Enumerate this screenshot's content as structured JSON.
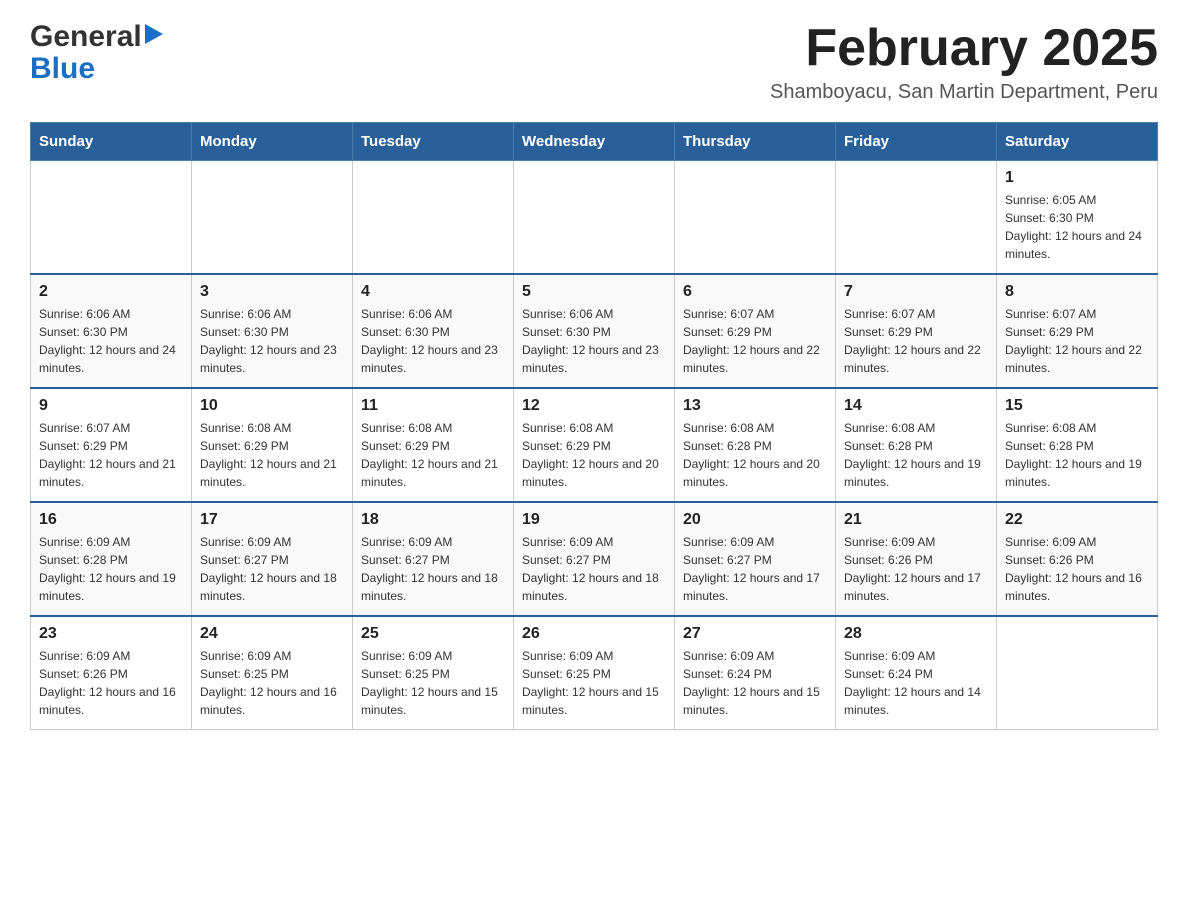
{
  "header": {
    "logo_general": "General",
    "logo_blue": "Blue",
    "title": "February 2025",
    "subtitle": "Shamboyacu, San Martin Department, Peru"
  },
  "weekdays": [
    "Sunday",
    "Monday",
    "Tuesday",
    "Wednesday",
    "Thursday",
    "Friday",
    "Saturday"
  ],
  "weeks": [
    [
      {
        "day": "",
        "info": ""
      },
      {
        "day": "",
        "info": ""
      },
      {
        "day": "",
        "info": ""
      },
      {
        "day": "",
        "info": ""
      },
      {
        "day": "",
        "info": ""
      },
      {
        "day": "",
        "info": ""
      },
      {
        "day": "1",
        "info": "Sunrise: 6:05 AM\nSunset: 6:30 PM\nDaylight: 12 hours and 24 minutes."
      }
    ],
    [
      {
        "day": "2",
        "info": "Sunrise: 6:06 AM\nSunset: 6:30 PM\nDaylight: 12 hours and 24 minutes."
      },
      {
        "day": "3",
        "info": "Sunrise: 6:06 AM\nSunset: 6:30 PM\nDaylight: 12 hours and 23 minutes."
      },
      {
        "day": "4",
        "info": "Sunrise: 6:06 AM\nSunset: 6:30 PM\nDaylight: 12 hours and 23 minutes."
      },
      {
        "day": "5",
        "info": "Sunrise: 6:06 AM\nSunset: 6:30 PM\nDaylight: 12 hours and 23 minutes."
      },
      {
        "day": "6",
        "info": "Sunrise: 6:07 AM\nSunset: 6:29 PM\nDaylight: 12 hours and 22 minutes."
      },
      {
        "day": "7",
        "info": "Sunrise: 6:07 AM\nSunset: 6:29 PM\nDaylight: 12 hours and 22 minutes."
      },
      {
        "day": "8",
        "info": "Sunrise: 6:07 AM\nSunset: 6:29 PM\nDaylight: 12 hours and 22 minutes."
      }
    ],
    [
      {
        "day": "9",
        "info": "Sunrise: 6:07 AM\nSunset: 6:29 PM\nDaylight: 12 hours and 21 minutes."
      },
      {
        "day": "10",
        "info": "Sunrise: 6:08 AM\nSunset: 6:29 PM\nDaylight: 12 hours and 21 minutes."
      },
      {
        "day": "11",
        "info": "Sunrise: 6:08 AM\nSunset: 6:29 PM\nDaylight: 12 hours and 21 minutes."
      },
      {
        "day": "12",
        "info": "Sunrise: 6:08 AM\nSunset: 6:29 PM\nDaylight: 12 hours and 20 minutes."
      },
      {
        "day": "13",
        "info": "Sunrise: 6:08 AM\nSunset: 6:28 PM\nDaylight: 12 hours and 20 minutes."
      },
      {
        "day": "14",
        "info": "Sunrise: 6:08 AM\nSunset: 6:28 PM\nDaylight: 12 hours and 19 minutes."
      },
      {
        "day": "15",
        "info": "Sunrise: 6:08 AM\nSunset: 6:28 PM\nDaylight: 12 hours and 19 minutes."
      }
    ],
    [
      {
        "day": "16",
        "info": "Sunrise: 6:09 AM\nSunset: 6:28 PM\nDaylight: 12 hours and 19 minutes."
      },
      {
        "day": "17",
        "info": "Sunrise: 6:09 AM\nSunset: 6:27 PM\nDaylight: 12 hours and 18 minutes."
      },
      {
        "day": "18",
        "info": "Sunrise: 6:09 AM\nSunset: 6:27 PM\nDaylight: 12 hours and 18 minutes."
      },
      {
        "day": "19",
        "info": "Sunrise: 6:09 AM\nSunset: 6:27 PM\nDaylight: 12 hours and 18 minutes."
      },
      {
        "day": "20",
        "info": "Sunrise: 6:09 AM\nSunset: 6:27 PM\nDaylight: 12 hours and 17 minutes."
      },
      {
        "day": "21",
        "info": "Sunrise: 6:09 AM\nSunset: 6:26 PM\nDaylight: 12 hours and 17 minutes."
      },
      {
        "day": "22",
        "info": "Sunrise: 6:09 AM\nSunset: 6:26 PM\nDaylight: 12 hours and 16 minutes."
      }
    ],
    [
      {
        "day": "23",
        "info": "Sunrise: 6:09 AM\nSunset: 6:26 PM\nDaylight: 12 hours and 16 minutes."
      },
      {
        "day": "24",
        "info": "Sunrise: 6:09 AM\nSunset: 6:25 PM\nDaylight: 12 hours and 16 minutes."
      },
      {
        "day": "25",
        "info": "Sunrise: 6:09 AM\nSunset: 6:25 PM\nDaylight: 12 hours and 15 minutes."
      },
      {
        "day": "26",
        "info": "Sunrise: 6:09 AM\nSunset: 6:25 PM\nDaylight: 12 hours and 15 minutes."
      },
      {
        "day": "27",
        "info": "Sunrise: 6:09 AM\nSunset: 6:24 PM\nDaylight: 12 hours and 15 minutes."
      },
      {
        "day": "28",
        "info": "Sunrise: 6:09 AM\nSunset: 6:24 PM\nDaylight: 12 hours and 14 minutes."
      },
      {
        "day": "",
        "info": ""
      }
    ]
  ]
}
